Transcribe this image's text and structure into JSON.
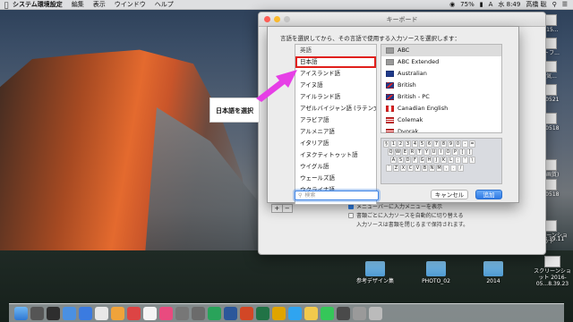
{
  "menubar": {
    "app_name": "システム環境設定",
    "menus": [
      "編集",
      "表示",
      "ウインドウ",
      "ヘルプ"
    ],
    "battery": "75%",
    "time": "水 8:49",
    "user": "高橋 聡"
  },
  "window": {
    "title": "キーボード",
    "option1": "メニューバーに入力メニューを表示",
    "option2": "書類ごとに入力ソースを自動的に切り替える",
    "note": "入力ソースは書類を閉じるまで保持されます。"
  },
  "sheet": {
    "prompt": "言語を選択してから、その言語で使用する入力ソースを選択します：",
    "languages": [
      "英語",
      "日本語",
      "アイスランド語",
      "アイヌ語",
      "アイルランド語",
      "アゼルバイジャン語 (ラテン文字)",
      "アラビア語",
      "アルメニア語",
      "イタリア語",
      "イヌクティトゥット語",
      "ウイグル語",
      "ウェールズ語",
      "ウクライナ語"
    ],
    "selected_language": "日本語",
    "sources": [
      {
        "label": "ABC",
        "flag": "abc"
      },
      {
        "label": "ABC Extended",
        "flag": "abc"
      },
      {
        "label": "Australian",
        "flag": "au"
      },
      {
        "label": "British",
        "flag": "uk"
      },
      {
        "label": "British - PC",
        "flag": "uk"
      },
      {
        "label": "Canadian English",
        "flag": "ca"
      },
      {
        "label": "Colemak",
        "flag": "us"
      },
      {
        "label": "Dvorak",
        "flag": "us"
      }
    ],
    "search_placeholder": "検索",
    "cancel_label": "キャンセル",
    "add_label": "追加",
    "keyboard_rows": [
      [
        "§",
        "1",
        "2",
        "3",
        "4",
        "5",
        "6",
        "7",
        "8",
        "9",
        "0",
        "-",
        "="
      ],
      [
        "Q",
        "W",
        "E",
        "R",
        "T",
        "Y",
        "U",
        "I",
        "O",
        "P",
        "[",
        "]"
      ],
      [
        "A",
        "S",
        "D",
        "F",
        "G",
        "H",
        "J",
        "K",
        "L",
        ";",
        "'",
        "\\"
      ],
      [
        "`",
        "Z",
        "X",
        "C",
        "V",
        "B",
        "N",
        "M",
        ",",
        ".",
        "/"
      ]
    ]
  },
  "annotation": {
    "text": "日本語を選択",
    "arrow_color": "#e63fe6"
  },
  "desktop_icons": [
    {
      "label": "2015...",
      "kind": "thumb"
    },
    {
      "label": "ットフ...",
      "kind": "thumb"
    },
    {
      "label": "お気...",
      "kind": "thumb"
    },
    {
      "label": "150521",
      "kind": "thumb"
    },
    {
      "label": "150518",
      "kind": "thumb"
    },
    {
      "label": "(高画質)",
      "kind": "thumb"
    },
    {
      "label": "150518",
      "kind": "thumb"
    },
    {
      "label": "スクリーンショット",
      "kind": "thumb"
    },
    {
      "label": "...6.8.39.11",
      "kind": "thumb"
    },
    {
      "label": "参考デザイン集",
      "kind": "folder"
    },
    {
      "label": "PHOTO_02",
      "kind": "folder"
    },
    {
      "label": "2014",
      "kind": "folder"
    },
    {
      "label": "スクリーンショット 2016-05...8.39.23",
      "kind": "thumb"
    }
  ],
  "colors": {
    "selection_outline": "#e0201c",
    "accent": "#2e7ae6"
  }
}
